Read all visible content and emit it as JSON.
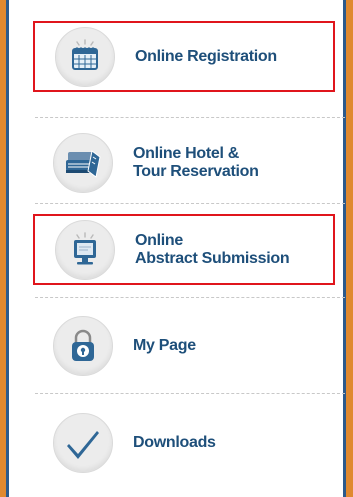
{
  "menu": {
    "items": [
      {
        "icon": "calendar-icon",
        "lines": [
          "Online Registration"
        ]
      },
      {
        "icon": "hotel-ticket-icon",
        "lines": [
          "Online Hotel &",
          "Tour Reservation"
        ]
      },
      {
        "icon": "monitor-icon",
        "lines": [
          "Online",
          "Abstract Submission"
        ]
      },
      {
        "icon": "lock-icon",
        "lines": [
          "My Page"
        ]
      },
      {
        "icon": "checkmark-icon",
        "lines": [
          "Downloads"
        ]
      }
    ]
  },
  "colors": {
    "frame_orange": "#e0892f",
    "frame_blue": "#2b5a8c",
    "label_blue": "#1e4f7a",
    "highlight_red": "#e0151c"
  }
}
